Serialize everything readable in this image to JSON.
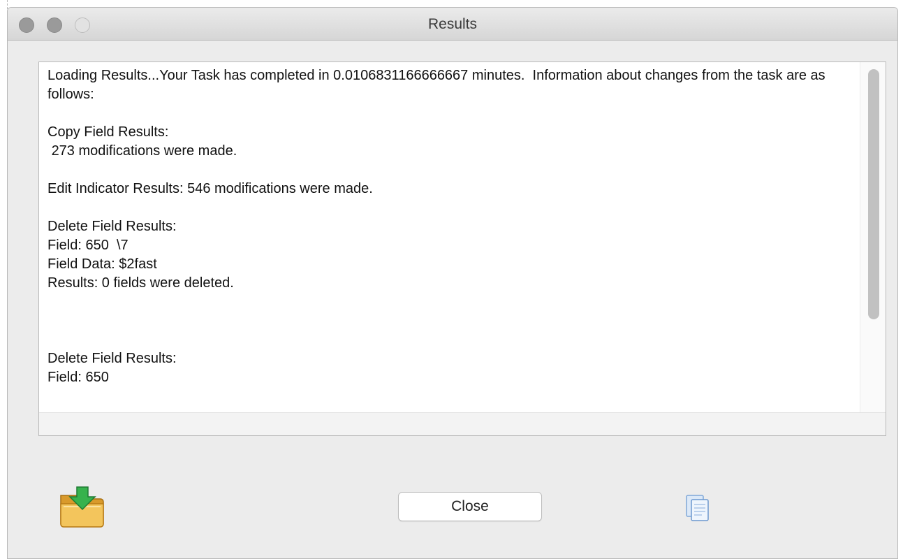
{
  "window": {
    "title": "Results"
  },
  "results_text": "Loading Results...Your Task has completed in 0.0106831166666667 minutes.  Information about changes from the task are as follows:\n\nCopy Field Results:\n 273 modifications were made.\n\nEdit Indicator Results: 546 modifications were made.\n\nDelete Field Results:\nField: 650  \\7\nField Data: $2fast\nResults: 0 fields were deleted.\n\n\n\nDelete Field Results:\nField: 650",
  "buttons": {
    "close_label": "Close"
  },
  "icons": {
    "save": "folder-download-icon",
    "copy": "copy-document-icon",
    "colors": {
      "folder": "#e8b54a",
      "arrow": "#2fa84f"
    }
  }
}
